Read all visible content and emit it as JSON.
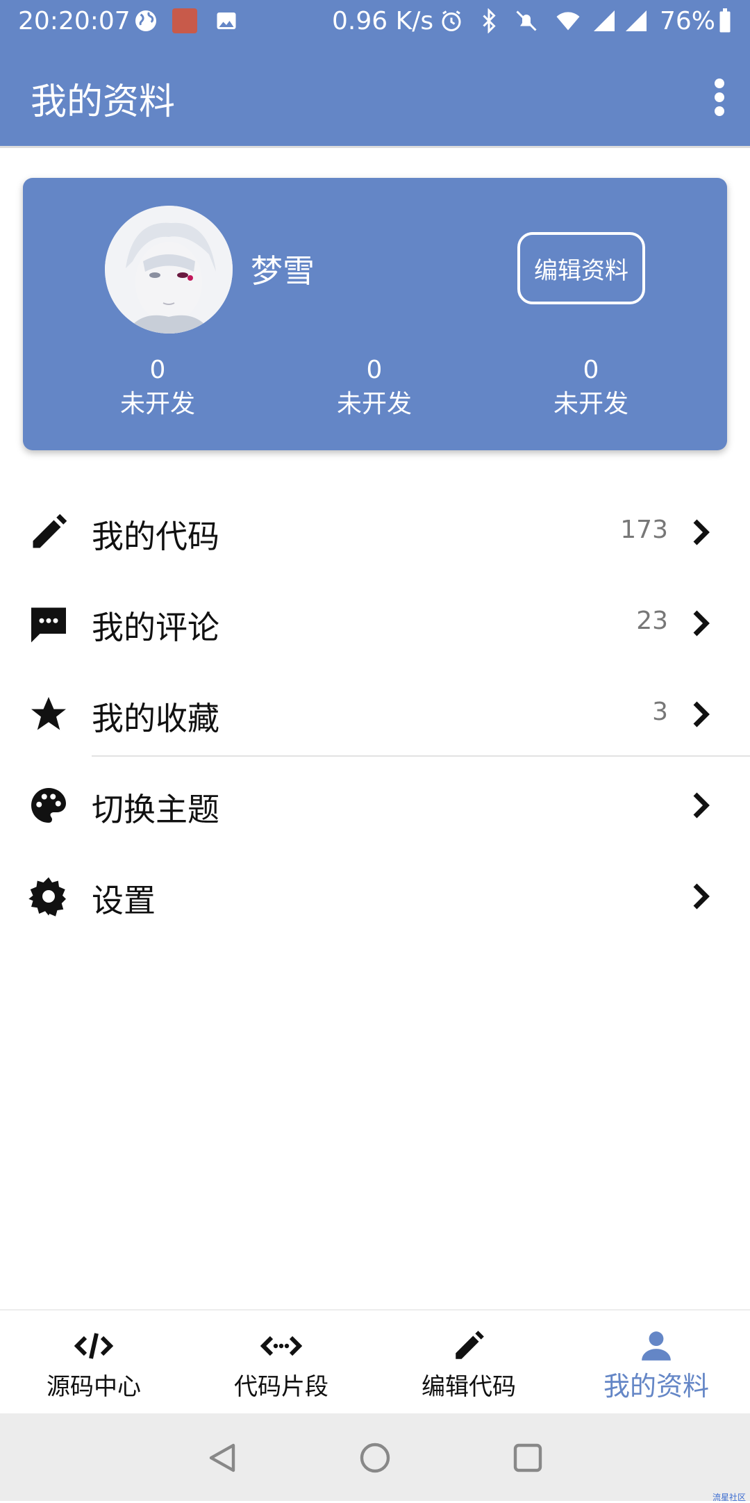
{
  "status_bar": {
    "time": "20:20:07",
    "speed": "0.96 K/s",
    "battery": "76%"
  },
  "app_bar": {
    "title": "我的资料"
  },
  "profile": {
    "nickname": "梦雪",
    "edit_label": "编辑资料",
    "stats": [
      {
        "value": "0",
        "label": "未开发"
      },
      {
        "value": "0",
        "label": "未开发"
      },
      {
        "value": "0",
        "label": "未开发"
      }
    ]
  },
  "menu": {
    "items": [
      {
        "icon": "pencil-icon",
        "label": "我的代码",
        "count": "173"
      },
      {
        "icon": "comment-icon",
        "label": "我的评论",
        "count": "23"
      },
      {
        "icon": "star-icon",
        "label": "我的收藏",
        "count": "3"
      },
      {
        "icon": "palette-icon",
        "label": "切换主题",
        "count": ""
      },
      {
        "icon": "gear-icon",
        "label": "设置",
        "count": ""
      }
    ]
  },
  "bottom_nav": {
    "tabs": [
      {
        "icon": "code-icon",
        "label": "源码中心"
      },
      {
        "icon": "code-snippet-icon",
        "label": "代码片段"
      },
      {
        "icon": "pencil-icon",
        "label": "编辑代码"
      },
      {
        "icon": "person-icon",
        "label": "我的资料",
        "active": true
      }
    ]
  },
  "watermark": "流星社区",
  "colors": {
    "primary": "#6486c6",
    "background": "#ffffff",
    "nav_background": "#ececec"
  }
}
